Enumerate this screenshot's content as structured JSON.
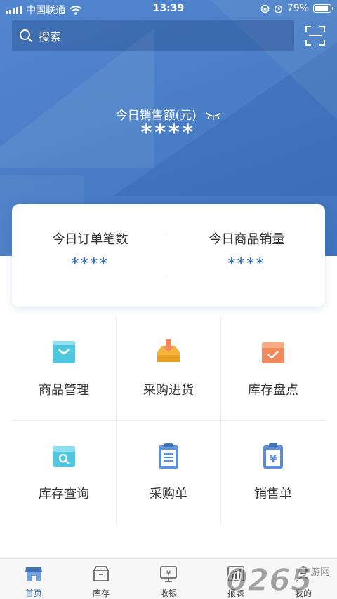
{
  "status_bar": {
    "carrier": "中国联通",
    "time": "13:39",
    "battery": "79%",
    "battery_level": 0.79
  },
  "search": {
    "placeholder": "搜索"
  },
  "summary": {
    "sales_label": "今日销售额(元)",
    "sales_value": "****"
  },
  "stats": [
    {
      "label": "今日订单笔数",
      "value": "****"
    },
    {
      "label": "今日商品销量",
      "value": "****"
    }
  ],
  "menu": [
    {
      "label": "商品管理",
      "icon": "shopping-bag-icon"
    },
    {
      "label": "采购进货",
      "icon": "inbox-download-icon"
    },
    {
      "label": "库存盘点",
      "icon": "box-check-icon"
    },
    {
      "label": "库存查询",
      "icon": "box-search-icon"
    },
    {
      "label": "采购单",
      "icon": "clipboard-list-icon"
    },
    {
      "label": "销售单",
      "icon": "clipboard-yen-icon"
    }
  ],
  "tabs": [
    {
      "label": "首页",
      "icon": "store-icon",
      "active": true
    },
    {
      "label": "库存",
      "icon": "box-icon",
      "active": false
    },
    {
      "label": "收银",
      "icon": "cashier-monitor-icon",
      "active": false
    },
    {
      "label": "报表",
      "icon": "bar-chart-icon",
      "active": false
    },
    {
      "label": "我的",
      "icon": "user-icon",
      "active": false
    }
  ],
  "watermark": {
    "text": "0265",
    "sub": "手游网"
  },
  "colors": {
    "primary": "#3e71b8",
    "hero": "#4a7ec6",
    "cyan": "#4fc8df",
    "orange": "#f08a5d",
    "yellow": "#f3b63a",
    "blue_icon": "#5b8fdb"
  }
}
